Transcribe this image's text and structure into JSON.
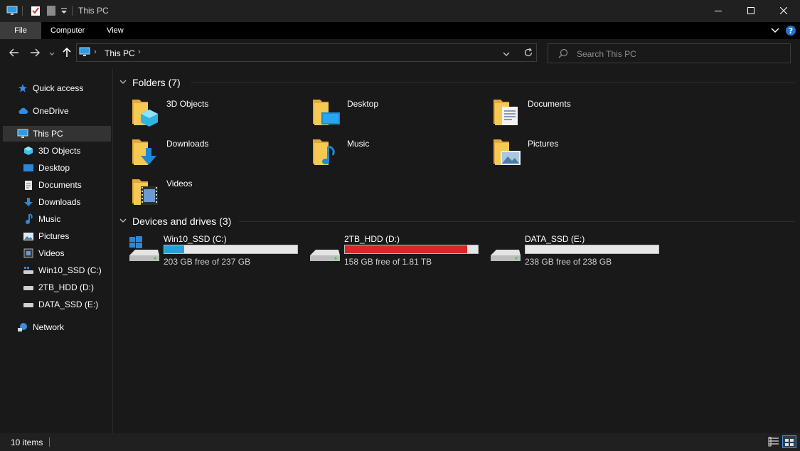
{
  "window": {
    "title": "This PC",
    "minimize_icon": "minimize-icon",
    "maximize_icon": "maximize-icon",
    "close_icon": "close-icon"
  },
  "ribbon": {
    "tabs": [
      "File",
      "Computer",
      "View"
    ]
  },
  "nav": {
    "address": "This PC",
    "search_placeholder": "Search This PC"
  },
  "sidebar": {
    "items": [
      {
        "label": "Quick access",
        "icon": "star-icon"
      },
      {
        "label": "OneDrive",
        "icon": "cloud-icon"
      },
      {
        "label": "This PC",
        "icon": "computer-icon",
        "selected": true
      },
      {
        "label": "3D Objects",
        "icon": "cube-icon"
      },
      {
        "label": "Desktop",
        "icon": "desktop-icon"
      },
      {
        "label": "Documents",
        "icon": "document-icon"
      },
      {
        "label": "Downloads",
        "icon": "download-icon"
      },
      {
        "label": "Music",
        "icon": "music-icon"
      },
      {
        "label": "Pictures",
        "icon": "picture-icon"
      },
      {
        "label": "Videos",
        "icon": "video-icon"
      },
      {
        "label": "Win10_SSD (C:)",
        "icon": "system-drive-icon"
      },
      {
        "label": "2TB_HDD (D:)",
        "icon": "drive-icon"
      },
      {
        "label": "DATA_SSD (E:)",
        "icon": "drive-icon"
      },
      {
        "label": "Network",
        "icon": "network-icon"
      }
    ]
  },
  "main": {
    "folders_header": "Folders (7)",
    "folders": [
      {
        "label": "3D Objects",
        "icon": "cube-folder-icon"
      },
      {
        "label": "Desktop",
        "icon": "desktop-folder-icon"
      },
      {
        "label": "Documents",
        "icon": "documents-folder-icon"
      },
      {
        "label": "Downloads",
        "icon": "downloads-folder-icon"
      },
      {
        "label": "Music",
        "icon": "music-folder-icon"
      },
      {
        "label": "Pictures",
        "icon": "pictures-folder-icon"
      },
      {
        "label": "Videos",
        "icon": "videos-folder-icon"
      }
    ],
    "drives_header": "Devices and drives (3)",
    "drives": [
      {
        "name": "Win10_SSD (C:)",
        "free": "203 GB free of 237 GB",
        "used_fraction": 0.15,
        "bar_color": "#26a0da",
        "icon": "system-drive-icon"
      },
      {
        "name": "2TB_HDD (D:)",
        "free": "158 GB free of 1.81 TB",
        "used_fraction": 0.92,
        "bar_color": "#da2626",
        "icon": "drive-icon"
      },
      {
        "name": "DATA_SSD (E:)",
        "free": "238 GB free of 238 GB",
        "used_fraction": 0.0,
        "bar_color": "#26a0da",
        "icon": "drive-icon"
      }
    ]
  },
  "status": {
    "items_count": "10 items"
  },
  "colors": {
    "accent": "#26a0da",
    "warning": "#da2626",
    "folder": "#f4c04e"
  }
}
